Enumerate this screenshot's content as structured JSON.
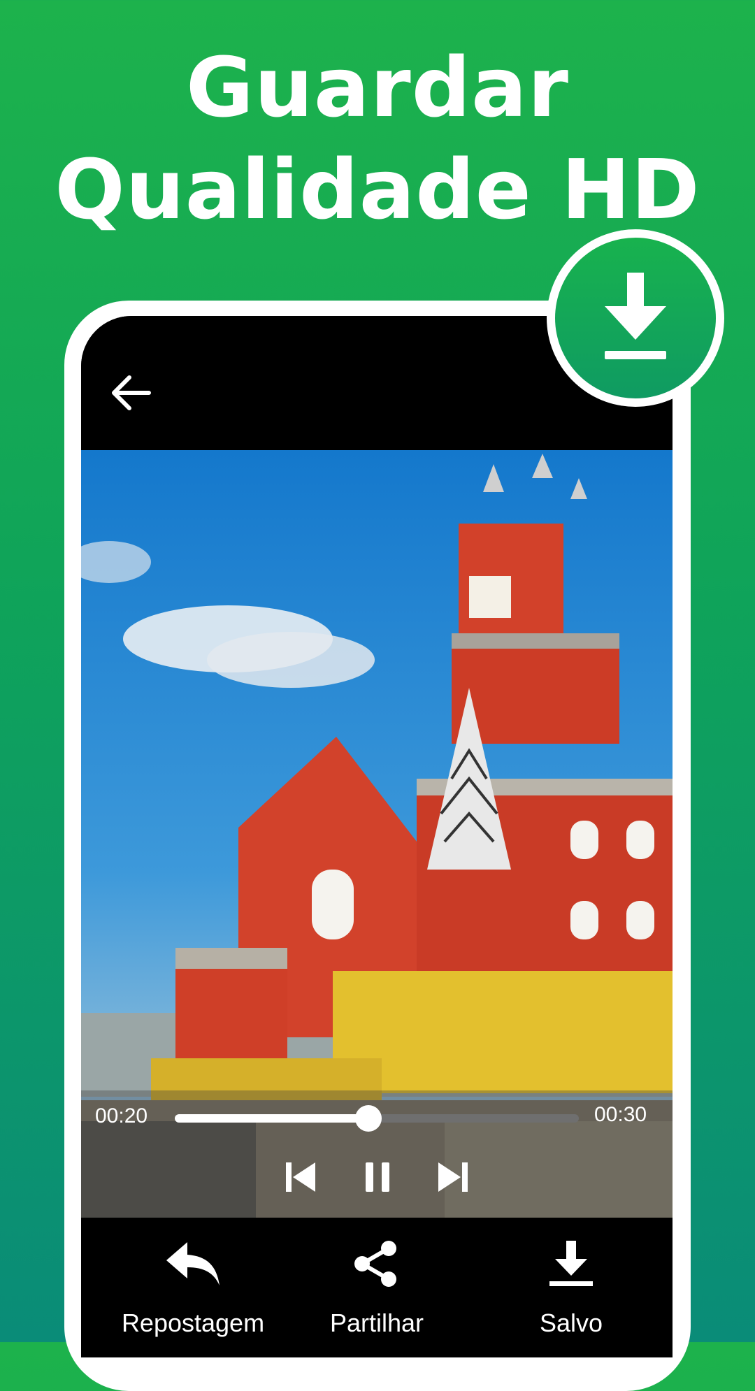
{
  "headline": {
    "line1": "Guardar",
    "line2": "Qualidade HD"
  },
  "player": {
    "current_time": "00:20",
    "total_time": "00:30",
    "progress": 0.48
  },
  "actions": [
    {
      "label": "Repostagem",
      "icon": "repost-icon"
    },
    {
      "label": "Partilhar",
      "icon": "share-icon"
    },
    {
      "label": "Salvo",
      "icon": "download-icon"
    }
  ],
  "colors": {
    "brand_green": "#1db24c",
    "accent_teal": "#0a8c78"
  }
}
